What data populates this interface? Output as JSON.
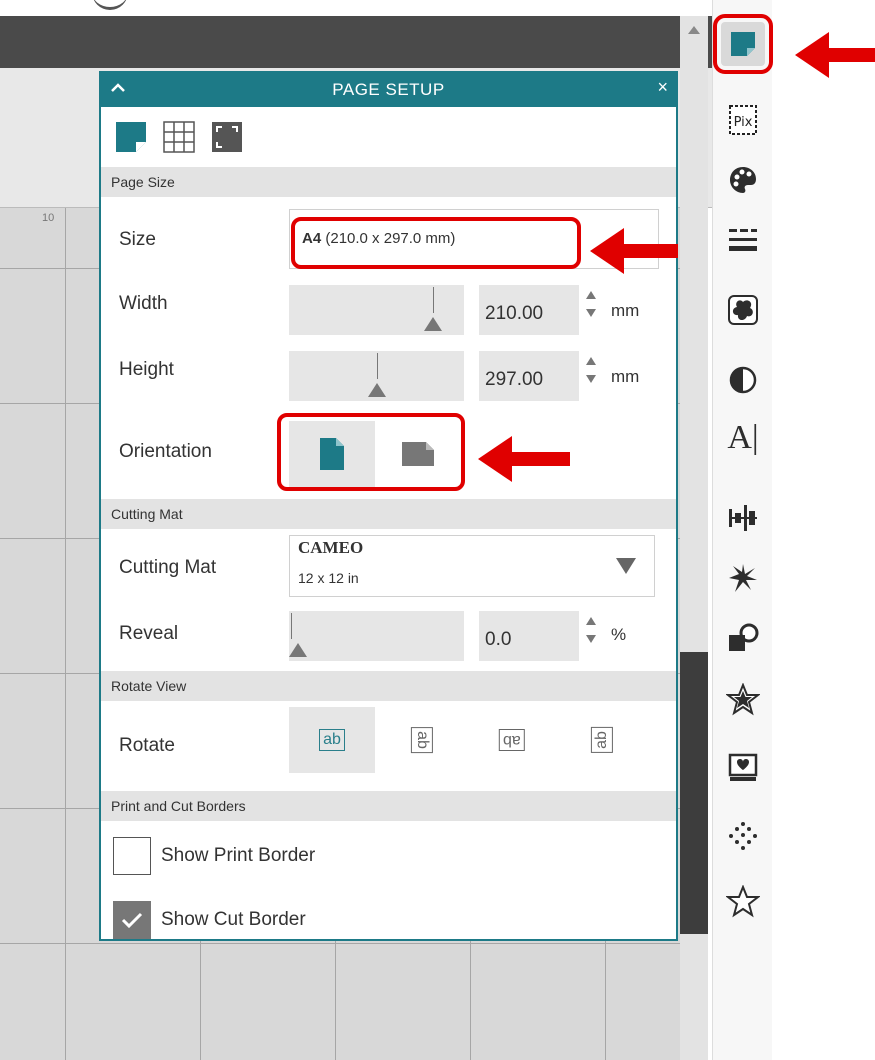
{
  "panel": {
    "title": "PAGE SETUP",
    "close_glyph": "×",
    "tabs": [
      {
        "name": "page-tab",
        "icon": "page-icon",
        "active": true
      },
      {
        "name": "grid-tab",
        "icon": "grid-icon",
        "active": false
      },
      {
        "name": "registration-tab",
        "icon": "registration-marks-icon",
        "active": false
      }
    ]
  },
  "page_size": {
    "section_title": "Page Size",
    "size_label": "Size",
    "size_value_bold": "A4",
    "size_value_detail": "(210.0 x 297.0 mm)",
    "width_label": "Width",
    "width_value": "210.00",
    "width_unit": "mm",
    "height_label": "Height",
    "height_value": "297.00",
    "height_unit": "mm",
    "orientation_label": "Orientation",
    "orientation_selected": "portrait"
  },
  "cutting_mat": {
    "section_title": "Cutting Mat",
    "mat_label": "Cutting Mat",
    "mat_name": "CAMEO",
    "mat_size": "12 x 12 in",
    "reveal_label": "Reveal",
    "reveal_value": "0.0",
    "reveal_unit": "%"
  },
  "rotate_view": {
    "section_title": "Rotate View",
    "rotate_label": "Rotate",
    "options": [
      {
        "name": "rotate-0",
        "glyph": "ab",
        "selected": true
      },
      {
        "name": "rotate-90",
        "glyph": "ab",
        "selected": false
      },
      {
        "name": "rotate-180",
        "glyph": "ab",
        "selected": false
      },
      {
        "name": "rotate-270",
        "glyph": "ab",
        "selected": false
      }
    ]
  },
  "print_cut_borders": {
    "section_title": "Print and Cut Borders",
    "show_print_border_label": "Show Print Border",
    "show_print_border_checked": false,
    "show_cut_border_label": "Show Cut Border",
    "show_cut_border_checked": true
  },
  "ruler": {
    "tick_label": "10"
  },
  "toolstrip": [
    {
      "name": "page-setup-tool",
      "icon": "page-setup-icon"
    },
    {
      "name": "pixscan-tool",
      "icon": "pix-icon",
      "label": "Pix"
    },
    {
      "name": "fill-tool",
      "icon": "palette-icon"
    },
    {
      "name": "line-style-tool",
      "icon": "line-style-icon"
    },
    {
      "name": "offset-tool",
      "icon": "offset-icon"
    },
    {
      "name": "image-effects-tool",
      "icon": "contrast-icon"
    },
    {
      "name": "text-tool",
      "icon": "text-icon",
      "label": "A|"
    },
    {
      "name": "align-tool",
      "icon": "align-icon"
    },
    {
      "name": "replicate-tool",
      "icon": "replicate-icon"
    },
    {
      "name": "modify-tool",
      "icon": "modify-icon"
    },
    {
      "name": "library-tool",
      "icon": "star-icon"
    },
    {
      "name": "store-tool",
      "icon": "store-icon"
    },
    {
      "name": "sketch-tool",
      "icon": "dots-icon"
    },
    {
      "name": "favorites-tool",
      "icon": "star-outline-icon"
    }
  ],
  "colors": {
    "accent": "#1d7a87",
    "annotation": "#e00000"
  }
}
